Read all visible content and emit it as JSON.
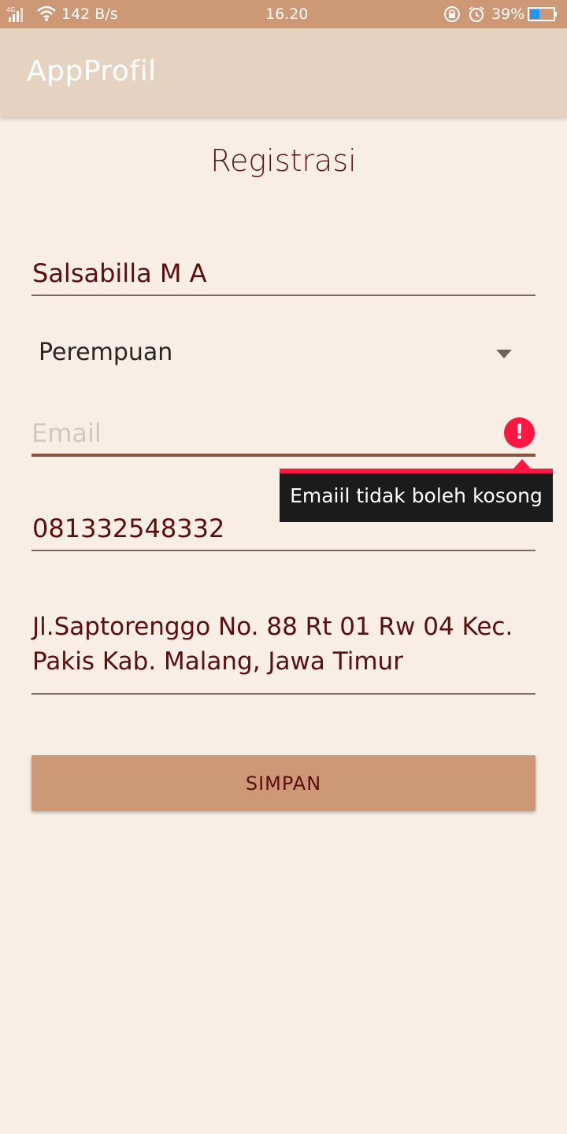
{
  "status_bar": {
    "network": "4G",
    "speed": "142 B/s",
    "time": "16.20",
    "battery": "39%",
    "icons": [
      "signal-icon",
      "wifi-icon",
      "rotation-lock-icon",
      "alarm-icon",
      "battery-icon"
    ]
  },
  "app_bar": {
    "title": "AppProfil"
  },
  "form": {
    "title": "Registrasi",
    "name_value": "Salsabilla M A",
    "gender_value": "Perempuan",
    "email_value": "",
    "email_placeholder": "Email",
    "email_error": "Emaiil tidak boleh kosong",
    "phone_value": "081332548332",
    "address_value": "Jl.Saptorenggo No. 88 Rt 01 Rw 04 Kec. Pakis Kab. Malang, Jawa Timur",
    "save_label": "SIMPAN"
  },
  "colors": {
    "status_bar": "#cd9875",
    "app_bar": "#e5d2c0",
    "background": "#f8eee5",
    "text": "#5a0f0c",
    "error": "#ff1744",
    "button": "#cd9875"
  }
}
